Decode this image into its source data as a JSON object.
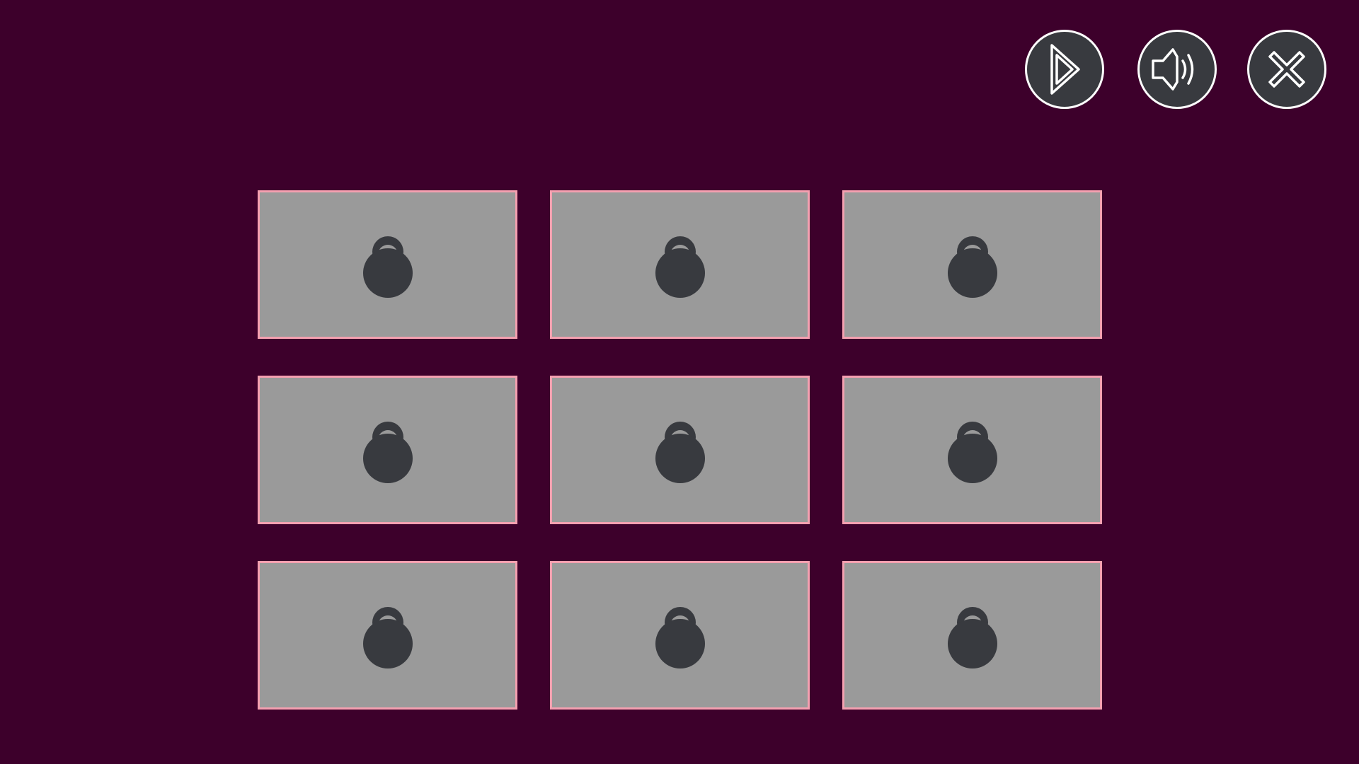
{
  "colors": {
    "background": "#3d002b",
    "button_fill": "#383a3f",
    "button_stroke": "#ffffff",
    "tile_fill": "#9a9a9a",
    "tile_border": "#f4a0b0",
    "lock_color": "#383a3f"
  },
  "toolbar": {
    "buttons": [
      {
        "id": "play",
        "icon": "play-icon"
      },
      {
        "id": "sound",
        "icon": "speaker-icon"
      },
      {
        "id": "close",
        "icon": "close-icon"
      }
    ]
  },
  "levels": [
    {
      "index": 1,
      "locked": true,
      "icon": "lock-icon"
    },
    {
      "index": 2,
      "locked": true,
      "icon": "lock-icon"
    },
    {
      "index": 3,
      "locked": true,
      "icon": "lock-icon"
    },
    {
      "index": 4,
      "locked": true,
      "icon": "lock-icon"
    },
    {
      "index": 5,
      "locked": true,
      "icon": "lock-icon"
    },
    {
      "index": 6,
      "locked": true,
      "icon": "lock-icon"
    },
    {
      "index": 7,
      "locked": true,
      "icon": "lock-icon"
    },
    {
      "index": 8,
      "locked": true,
      "icon": "lock-icon"
    },
    {
      "index": 9,
      "locked": true,
      "icon": "lock-icon"
    }
  ]
}
